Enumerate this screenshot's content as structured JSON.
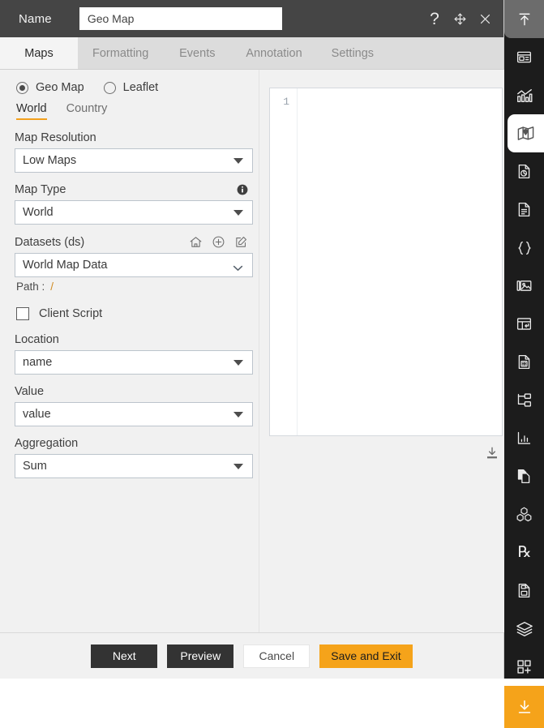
{
  "titlebar": {
    "name_label": "Name",
    "name_value": "Geo Map",
    "help_icon": "question-mark-icon",
    "move_icon": "move-arrows-icon",
    "close_icon": "close-x-icon"
  },
  "tabs": [
    {
      "label": "Maps",
      "active": true
    },
    {
      "label": "Formatting",
      "active": false
    },
    {
      "label": "Events",
      "active": false
    },
    {
      "label": "Annotation",
      "active": false
    },
    {
      "label": "Settings",
      "active": false
    }
  ],
  "map_mode": {
    "options": [
      {
        "label": "Geo Map",
        "selected": true
      },
      {
        "label": "Leaflet",
        "selected": false
      }
    ]
  },
  "scope_tabs": [
    {
      "label": "World",
      "active": true
    },
    {
      "label": "Country",
      "active": false
    }
  ],
  "fields": {
    "map_resolution": {
      "label": "Map Resolution",
      "value": "Low Maps"
    },
    "map_type": {
      "label": "Map Type",
      "value": "World",
      "info_icon": "info-circle-icon"
    },
    "datasets": {
      "label": "Datasets (ds)",
      "value": "World Map Data",
      "icons": [
        "home-icon",
        "add-circle-icon",
        "edit-square-icon"
      ]
    },
    "path": {
      "label": "Path :",
      "value": "/"
    },
    "client_script": {
      "label": "Client Script",
      "checked": false
    },
    "location": {
      "label": "Location",
      "value": "name"
    },
    "value": {
      "label": "Value",
      "value": "value"
    },
    "aggregation": {
      "label": "Aggregation",
      "value": "Sum"
    }
  },
  "editor": {
    "line_number": "1",
    "content": "",
    "download_icon": "download-icon"
  },
  "footer": {
    "buttons": [
      {
        "label": "Next",
        "style": "dark"
      },
      {
        "label": "Preview",
        "style": "dark"
      },
      {
        "label": "Cancel",
        "style": "light"
      },
      {
        "label": "Save and Exit",
        "style": "accent"
      }
    ]
  },
  "rail": {
    "items": [
      {
        "name": "collapse-up-icon",
        "state": "top"
      },
      {
        "name": "dashboard-panel-icon",
        "state": "normal"
      },
      {
        "name": "chart-bars-icon",
        "state": "normal"
      },
      {
        "name": "map-pin-icon",
        "state": "selected"
      },
      {
        "name": "pie-report-icon",
        "state": "normal"
      },
      {
        "name": "document-icon",
        "state": "normal"
      },
      {
        "name": "code-braces-icon",
        "state": "normal"
      },
      {
        "name": "image-gallery-icon",
        "state": "normal"
      },
      {
        "name": "table-insert-icon",
        "state": "normal"
      },
      {
        "name": "calculator-doc-icon",
        "state": "normal"
      },
      {
        "name": "tree-folder-icon",
        "state": "normal"
      },
      {
        "name": "bar-stats-icon",
        "state": "normal"
      },
      {
        "name": "copy-doc-icon",
        "state": "normal"
      },
      {
        "name": "cubes-icon",
        "state": "normal"
      },
      {
        "name": "prescription-rx-icon",
        "state": "normal"
      },
      {
        "name": "save-doc-icon",
        "state": "normal"
      },
      {
        "name": "layers-icon",
        "state": "normal"
      },
      {
        "name": "add-widget-icon",
        "state": "normal"
      },
      {
        "name": "download-arrow-icon",
        "state": "accent"
      }
    ]
  },
  "colors": {
    "accent": "#f5a31a",
    "titlebar": "#454545",
    "rail": "#1c1c1c",
    "panel": "#f1f1f1"
  }
}
